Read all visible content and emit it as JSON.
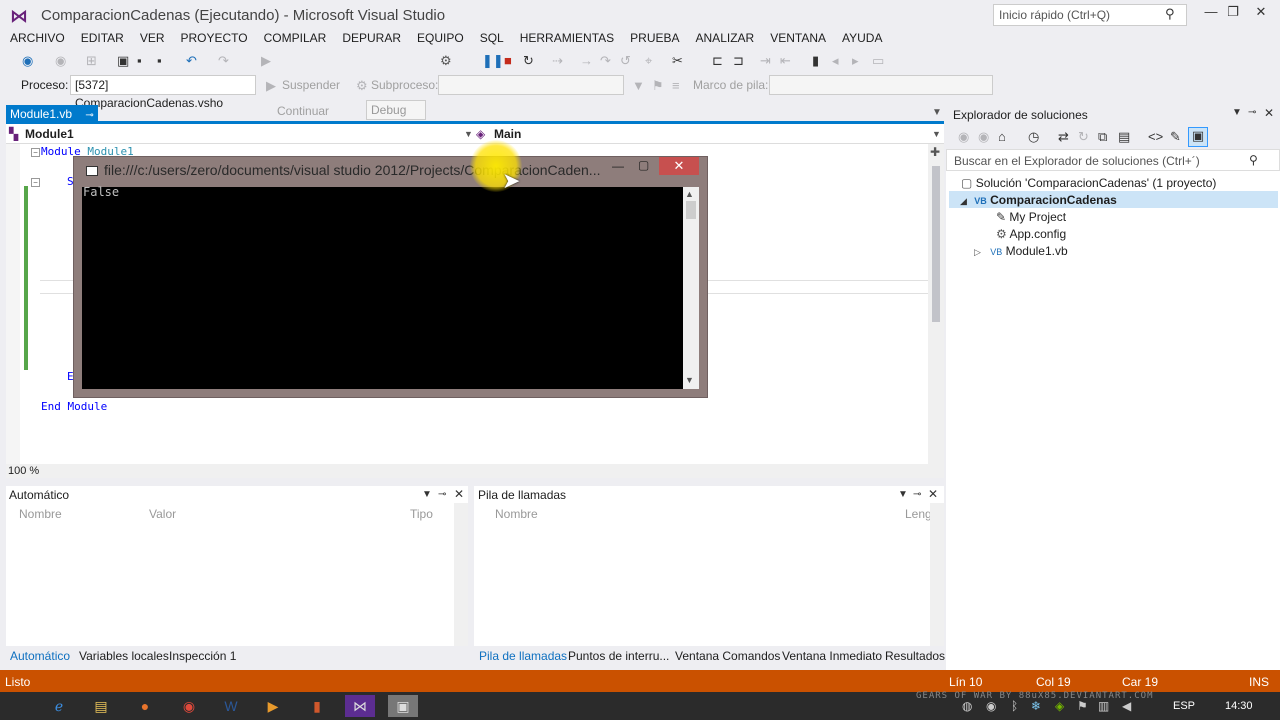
{
  "window": {
    "title": "ComparacionCadenas (Ejecutando) - Microsoft Visual Studio",
    "quick_launch_placeholder": "Inicio rápido (Ctrl+Q)"
  },
  "menu": [
    "ARCHIVO",
    "EDITAR",
    "VER",
    "PROYECTO",
    "COMPILAR",
    "DEPURAR",
    "EQUIPO",
    "SQL",
    "HERRAMIENTAS",
    "PRUEBA",
    "ANALIZAR",
    "VENTANA",
    "AYUDA"
  ],
  "toolbar": {
    "continue_label": "Continuar",
    "config_value": "Debug",
    "process_label": "Proceso:",
    "process_value": "[5372] ComparacionCadenas.vsho",
    "suspend_label": "Suspender",
    "thread_label": "Subproceso:",
    "stack_frame_label": "Marco de pila:"
  },
  "editor": {
    "tab_label": "Module1.vb",
    "nav_left": "Module1",
    "nav_right": "Main",
    "code_module_kw": "Module",
    "code_module_name": "Module1",
    "code_s": "S",
    "code_e": "E",
    "code_end": "End Module",
    "zoom": "100 %"
  },
  "console": {
    "title": "file:///c:/users/zero/documents/visual studio 2012/Projects/ComparacionCaden...",
    "output": "False"
  },
  "solution_explorer": {
    "title": "Explorador de soluciones",
    "search_placeholder": "Buscar en el Explorador de soluciones (Ctrl+´)",
    "solution": "Solución 'ComparacionCadenas'  (1 proyecto)",
    "project": "ComparacionCadenas",
    "items": [
      "My Project",
      "App.config",
      "Module1.vb"
    ]
  },
  "auto_panel": {
    "title": "Automático",
    "columns": [
      "Nombre",
      "Valor",
      "Tipo"
    ]
  },
  "calls_panel": {
    "title": "Pila de llamadas",
    "columns": [
      "Nombre",
      "Leng"
    ]
  },
  "bottom_tabs_left": [
    "Automático",
    "Variables locales",
    "Inspección 1"
  ],
  "bottom_tabs_right": [
    "Pila de llamadas",
    "Puntos de interru...",
    "Ventana Comandos",
    "Ventana Inmediato",
    "Resultados"
  ],
  "status": {
    "ready": "Listo",
    "line": "Lín 10",
    "col": "Col 19",
    "char": "Car 19",
    "mode": "INS"
  },
  "taskbar": {
    "watermark": "GEARS OF WAR  BY 88uX85.DEVIANTART.COM",
    "lang": "ESP",
    "clock": "14:30"
  }
}
